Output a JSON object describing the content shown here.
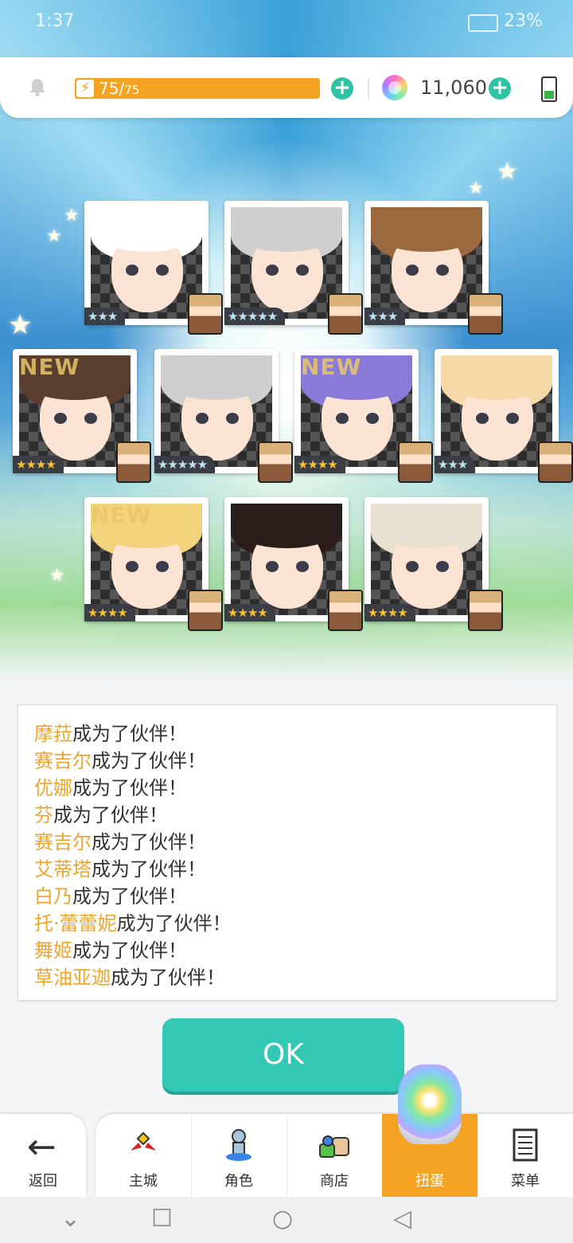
{
  "status": {
    "time": "1:37",
    "battery": "23%"
  },
  "resources": {
    "stamina_current": "75",
    "stamina_max": "75",
    "stamina_fraction": 1.0,
    "gems": "11,060"
  },
  "cards": [
    {
      "name": "card-1",
      "stars": "★★★",
      "star_style": "silver",
      "element": "light-icon",
      "element_glyph": "✦",
      "element_color": "#c7e36b",
      "hair": "#ffffff",
      "new": false
    },
    {
      "name": "card-2",
      "stars": "★★★★★",
      "star_style": "silver",
      "element": "dark-icon",
      "element_glyph": "✦",
      "element_color": "#3a2a55",
      "hair": "#cfcfcf",
      "new": false
    },
    {
      "name": "card-3",
      "stars": "★★★",
      "star_style": "silver",
      "element": "thunder-icon",
      "element_glyph": "⚡",
      "element_color": "#f5c518",
      "hair": "#9a6a3e",
      "new": false
    },
    {
      "name": "card-4",
      "stars": "★★★★",
      "star_style": "gold",
      "element": "light-icon",
      "element_glyph": "✦",
      "element_color": "#c7e36b",
      "hair": "#5a3f2f",
      "new": true
    },
    {
      "name": "card-5",
      "stars": "★★★★★",
      "star_style": "silver",
      "element": "dark-icon",
      "element_glyph": "✦",
      "element_color": "#3a2a55",
      "hair": "#cfcfcf",
      "new": false
    },
    {
      "name": "card-6",
      "stars": "★★★★",
      "star_style": "gold",
      "element": "thunder-icon",
      "element_glyph": "⚡",
      "element_color": "#f5c518",
      "hair": "#8a7bd8",
      "new": true
    },
    {
      "name": "card-7",
      "stars": "★★★",
      "star_style": "silver",
      "element": "water-icon",
      "element_glyph": "◉",
      "element_color": "#3a86e8",
      "hair": "#f5d9a8",
      "new": false
    },
    {
      "name": "card-8",
      "stars": "★★★★",
      "star_style": "gold",
      "element": "thunder-icon",
      "element_glyph": "⚡",
      "element_color": "#f5c518",
      "hair": "#f2d27a",
      "new": true
    },
    {
      "name": "card-9",
      "stars": "★★★★",
      "star_style": "gold",
      "element": "fire-icon",
      "element_glyph": "◆",
      "element_color": "#e33a3a",
      "hair": "#2b1d1a",
      "new": false
    },
    {
      "name": "card-10",
      "stars": "★★★★",
      "star_style": "gold",
      "element": "water-icon",
      "element_glyph": "◉",
      "element_color": "#3a86e8",
      "hair": "#e8e0d0",
      "new": false
    }
  ],
  "new_label": "NEW",
  "messages": [
    {
      "name": "摩菈",
      "text": "成为了伙伴！"
    },
    {
      "name": "赛吉尔",
      "text": "成为了伙伴！"
    },
    {
      "name": "优娜",
      "text": "成为了伙伴！"
    },
    {
      "name": "芬",
      "text": "成为了伙伴！"
    },
    {
      "name": "赛吉尔",
      "text": "成为了伙伴！"
    },
    {
      "name": "艾蒂塔",
      "text": "成为了伙伴！"
    },
    {
      "name": "白乃",
      "text": "成为了伙伴！"
    },
    {
      "name": "托·蕾蕾妮",
      "text": "成为了伙伴！"
    },
    {
      "name": "舞姬",
      "text": "成为了伙伴！"
    },
    {
      "name": "草油亚迦",
      "text": "成为了伙伴！"
    }
  ],
  "ok_label": "OK",
  "nav": {
    "back": "返回",
    "tabs": [
      "主城",
      "角色",
      "商店",
      "扭蛋",
      "菜单"
    ],
    "active_tab": "扭蛋"
  }
}
